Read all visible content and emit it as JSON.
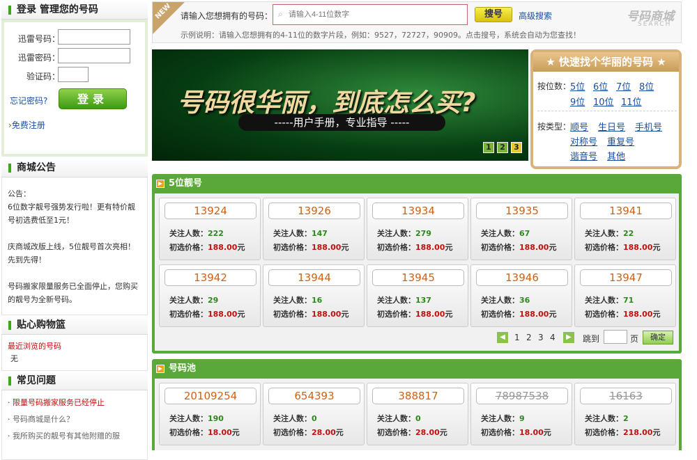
{
  "login": {
    "title": "登录 管理您的号码",
    "user_label": "迅雷号码：",
    "pass_label": "迅雷密码：",
    "code_label": "验证码：",
    "forgot": "忘记密码?",
    "submit": "登录",
    "register": "免费注册"
  },
  "notice": {
    "title": "商城公告",
    "intro": "公告：",
    "items": [
      "6位数字靓号强势发行啦！更有特价靓号初选费低至1元！",
      "庆商城改版上线，5位靓号首次亮相！先到先得！",
      "号码搬家限量服务已全面停止，您购买的靓号为全新号码。"
    ]
  },
  "cart": {
    "title": "贴心购物篮",
    "recent_label": "最近浏览的号码",
    "recent_value": "无"
  },
  "faq": {
    "title": "常见问题",
    "items": [
      "限量号码搬家服务已经停止",
      "号码商城是什么？",
      "我所购买的靓号有其他附赠的服"
    ]
  },
  "search": {
    "badge": "NEW",
    "label": "请输入您想拥有的号码：",
    "placeholder": "请输入4-11位数字",
    "button": "搜号",
    "advanced": "高级搜索",
    "hint": "示例说明：请输入您想拥有的4-11位的数字片段，例如：9527，72727，90909。点击搜号，系统会自动为您查找！",
    "logo_main": "号码商城",
    "logo_sub": "SEARCH"
  },
  "banner": {
    "headline": "号码很华丽，到底怎么买?",
    "sub": "-----用户手册，专业指导 -----",
    "pages": [
      "1",
      "2",
      "3"
    ]
  },
  "quick": {
    "title": "快速找个华丽的号码",
    "by_digits_label": "按位数：",
    "digits": [
      "5位",
      "6位",
      "7位",
      "8位",
      "9位",
      "10位",
      "11位"
    ],
    "by_type_label": "按类型：",
    "types": [
      "顺号",
      "生日号",
      "手机号",
      "对称号",
      "重复号",
      "谐音号",
      "其他"
    ]
  },
  "five": {
    "title": "5位靓号",
    "watch_label": "关注人数：",
    "price_label": "初选价格：",
    "unit": "元",
    "items": [
      {
        "num": "13924",
        "watch": "222",
        "price": "188.00"
      },
      {
        "num": "13926",
        "watch": "147",
        "price": "188.00"
      },
      {
        "num": "13934",
        "watch": "279",
        "price": "188.00"
      },
      {
        "num": "13935",
        "watch": "67",
        "price": "188.00"
      },
      {
        "num": "13941",
        "watch": "22",
        "price": "188.00"
      },
      {
        "num": "13942",
        "watch": "29",
        "price": "188.00"
      },
      {
        "num": "13944",
        "watch": "16",
        "price": "188.00"
      },
      {
        "num": "13945",
        "watch": "137",
        "price": "188.00"
      },
      {
        "num": "13946",
        "watch": "36",
        "price": "188.00"
      },
      {
        "num": "13947",
        "watch": "71",
        "price": "188.00"
      }
    ],
    "pages": [
      "1",
      "2",
      "3",
      "4"
    ],
    "jump_label": "跳到",
    "page_label": "页",
    "confirm": "确定"
  },
  "pool": {
    "title": "号码池",
    "items": [
      {
        "num": "20109254",
        "watch": "190",
        "price": "18.00",
        "strike": false
      },
      {
        "num": "654393",
        "watch": "0",
        "price": "28.00",
        "strike": false
      },
      {
        "num": "388817",
        "watch": "0",
        "price": "28.00",
        "strike": false
      },
      {
        "num": "78987538",
        "watch": "9",
        "price": "18.00",
        "strike": true
      },
      {
        "num": "16163",
        "watch": "2",
        "price": "218.00",
        "strike": true
      }
    ]
  }
}
